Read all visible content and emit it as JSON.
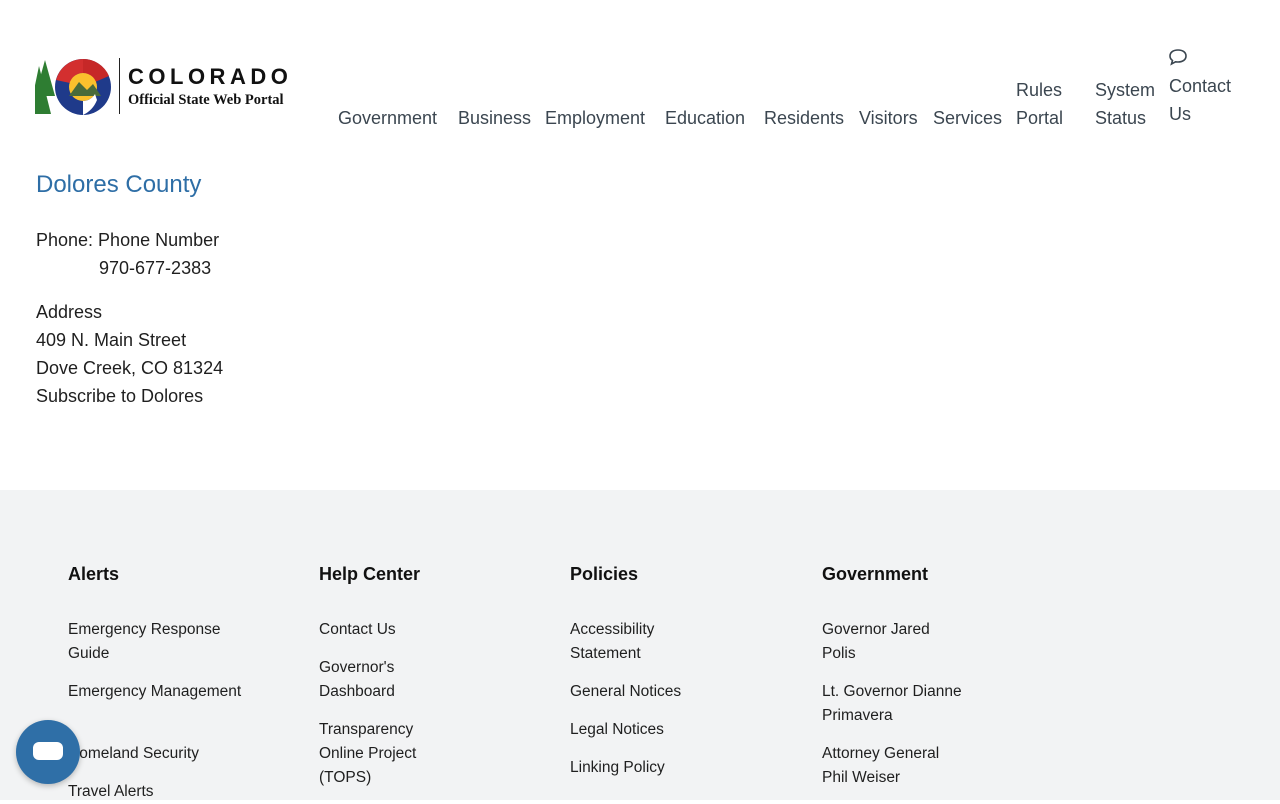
{
  "header": {
    "logo_title": "COLORADO",
    "logo_subtitle": "Official State Web Portal",
    "nav": {
      "government": "Government",
      "business": "Business",
      "employment": "Employment",
      "education": "Education",
      "residents": "Residents",
      "visitors": "Visitors",
      "services": "Services",
      "rules_1": "Rules",
      "rules_2": "Portal",
      "status_1": "System",
      "status_2": "Status",
      "contact_1": "Contact",
      "contact_2": "Us"
    },
    "icons": {
      "contact": "chat-icon"
    }
  },
  "main": {
    "county_title": "Dolores County",
    "phone_label": "Phone: Phone Number",
    "phone_number": "970-677-2383",
    "address_label": "Address",
    "address_line1": "409 N. Main Street",
    "address_line2": "Dove Creek, CO 81324",
    "subscribe": "Subscribe to Dolores"
  },
  "footer": {
    "alerts": {
      "heading": "Alerts",
      "links": [
        "Emergency Response Guide",
        "Emergency Management",
        "Homeland Security",
        "Travel Alerts"
      ]
    },
    "help": {
      "heading": "Help Center",
      "links": [
        "Contact Us",
        "Governor's Dashboard",
        "Transparency Online Project (TOPS)"
      ]
    },
    "policies": {
      "heading": "Policies",
      "links": [
        "Accessibility Statement",
        "General Notices",
        "Legal Notices",
        "Linking Policy"
      ]
    },
    "government": {
      "heading": "Government",
      "links": [
        "Governor Jared Polis",
        "Lt. Governor Dianne Primavera",
        "Attorney General Phil Weiser"
      ]
    }
  },
  "colors": {
    "link_blue": "#2e6ea6",
    "footer_bg": "#f2f3f4",
    "chat_button": "#2f6fa7"
  },
  "chat_widget": {
    "icon": "chat-bubble-icon"
  }
}
